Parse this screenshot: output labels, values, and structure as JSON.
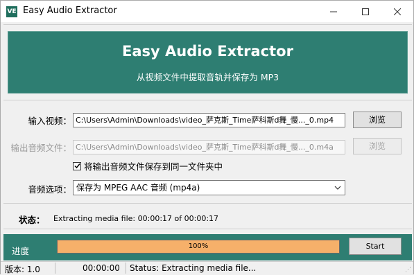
{
  "window": {
    "title": "Easy Audio Extractor",
    "icon_text": "VE"
  },
  "banner": {
    "title": "Easy Audio Extractor",
    "subtitle": "从视频文件中提取音轨并保存为 MP3"
  },
  "form": {
    "input_label": "输入视频：",
    "input_value": "C:\\Users\\Admin\\Downloads\\video_萨克斯_Time萨科斯d舞_慢..._0.mp4",
    "browse_input_label": "浏览",
    "output_label": "输出音频文件：",
    "output_value": "C:\\Users\\Admin\\Downloads\\video_萨克斯_Time萨科斯d舞_慢..._0.m4a",
    "browse_output_label": "浏览",
    "checkbox_label": "将输出音频文件保存到同一文件夹中",
    "checkbox_checked": true,
    "options_label": "音频选项：",
    "options_selected": "保存为 MPEG AAC 音频 (mp4a)"
  },
  "status": {
    "label": "状态：",
    "text": "Extracting media file: 00:00:17 of 00:00:17"
  },
  "progress": {
    "label": "进度",
    "percent": 100,
    "percent_text": "100%",
    "start_label": "Start"
  },
  "statusbar": {
    "version": "版本: 1.0",
    "time": "00:00:00",
    "status": "Status: Extracting media file..."
  },
  "colors": {
    "accent": "#2e7e72",
    "progress_fill": "#f6b06a"
  }
}
